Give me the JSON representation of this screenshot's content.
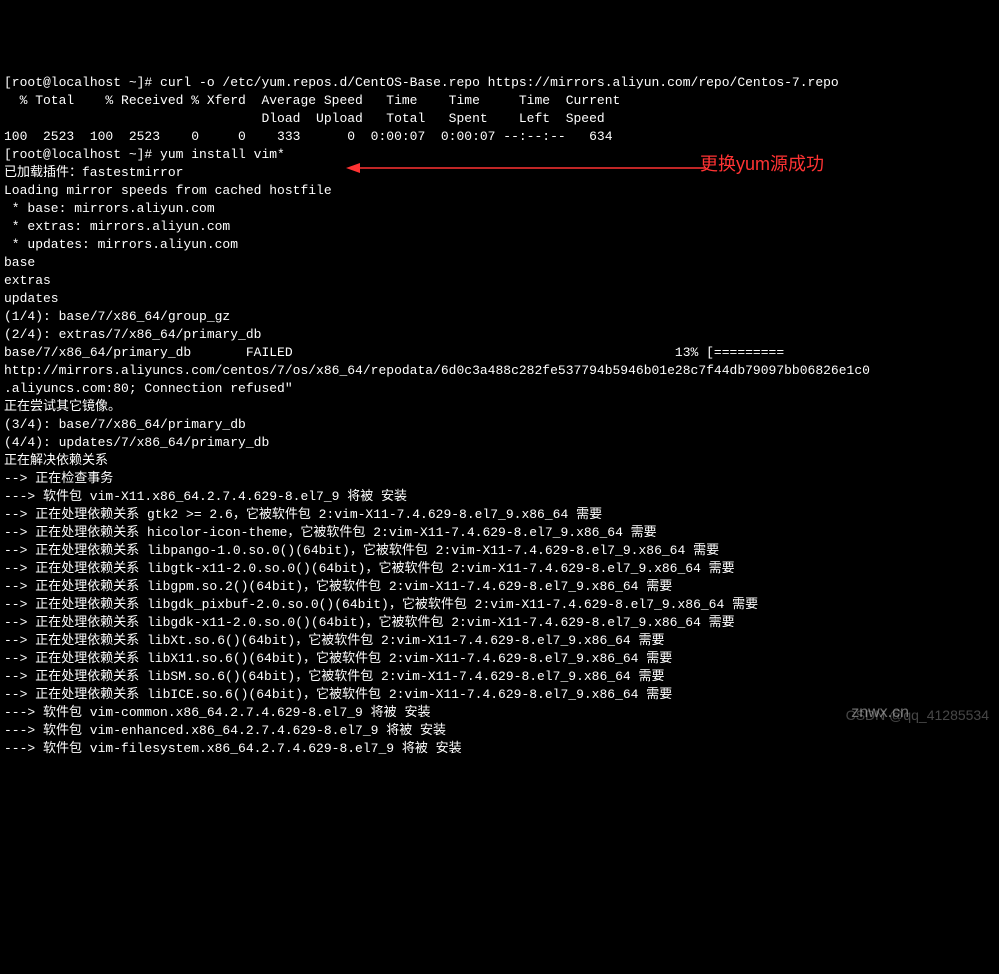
{
  "lines": [
    "[root@localhost ~]# curl -o /etc/yum.repos.d/CentOS-Base.repo https://mirrors.aliyun.com/repo/Centos-7.repo",
    "  % Total    % Received % Xferd  Average Speed   Time    Time     Time  Current",
    "                                 Dload  Upload   Total   Spent    Left  Speed",
    "100  2523  100  2523    0     0    333      0  0:00:07  0:00:07 --:--:--   634",
    "[root@localhost ~]# yum install vim*",
    "已加载插件：fastestmirror",
    "Loading mirror speeds from cached hostfile",
    " * base: mirrors.aliyun.com",
    " * extras: mirrors.aliyun.com",
    " * updates: mirrors.aliyun.com",
    "base",
    "extras",
    "updates",
    "(1/4): base/7/x86_64/group_gz",
    "(2/4): extras/7/x86_64/primary_db",
    "base/7/x86_64/primary_db       FAILED                                                 13% [=========",
    "http://mirrors.aliyuncs.com/centos/7/os/x86_64/repodata/6d0c3a488c282fe537794b5946b01e28c7f44db79097bb06826e1c0",
    ".aliyuncs.com:80; Connection refused\"",
    "正在尝试其它镜像。",
    "(3/4): base/7/x86_64/primary_db",
    "(4/4): updates/7/x86_64/primary_db",
    "正在解决依赖关系",
    "--> 正在检查事务",
    "---> 软件包 vim-X11.x86_64.2.7.4.629-8.el7_9 将被 安装",
    "--> 正在处理依赖关系 gtk2 >= 2.6，它被软件包 2:vim-X11-7.4.629-8.el7_9.x86_64 需要",
    "--> 正在处理依赖关系 hicolor-icon-theme，它被软件包 2:vim-X11-7.4.629-8.el7_9.x86_64 需要",
    "--> 正在处理依赖关系 libpango-1.0.so.0()(64bit)，它被软件包 2:vim-X11-7.4.629-8.el7_9.x86_64 需要",
    "--> 正在处理依赖关系 libgtk-x11-2.0.so.0()(64bit)，它被软件包 2:vim-X11-7.4.629-8.el7_9.x86_64 需要",
    "--> 正在处理依赖关系 libgpm.so.2()(64bit)，它被软件包 2:vim-X11-7.4.629-8.el7_9.x86_64 需要",
    "--> 正在处理依赖关系 libgdk_pixbuf-2.0.so.0()(64bit)，它被软件包 2:vim-X11-7.4.629-8.el7_9.x86_64 需要",
    "--> 正在处理依赖关系 libgdk-x11-2.0.so.0()(64bit)，它被软件包 2:vim-X11-7.4.629-8.el7_9.x86_64 需要",
    "--> 正在处理依赖关系 libXt.so.6()(64bit)，它被软件包 2:vim-X11-7.4.629-8.el7_9.x86_64 需要",
    "--> 正在处理依赖关系 libX11.so.6()(64bit)，它被软件包 2:vim-X11-7.4.629-8.el7_9.x86_64 需要",
    "--> 正在处理依赖关系 libSM.so.6()(64bit)，它被软件包 2:vim-X11-7.4.629-8.el7_9.x86_64 需要",
    "--> 正在处理依赖关系 libICE.so.6()(64bit)，它被软件包 2:vim-X11-7.4.629-8.el7_9.x86_64 需要",
    "---> 软件包 vim-common.x86_64.2.7.4.629-8.el7_9 将被 安装",
    "---> 软件包 vim-enhanced.x86_64.2.7.4.629-8.el7_9 将被 安装",
    "---> 软件包 vim-filesystem.x86_64.2.7.4.629-8.el7_9 将被 安装"
  ],
  "annotation": "更换yum源成功",
  "watermark_primary": "znwx.cn",
  "watermark_secondary": "CSDN @qq_41285534",
  "arrow_color": "#ff3333"
}
